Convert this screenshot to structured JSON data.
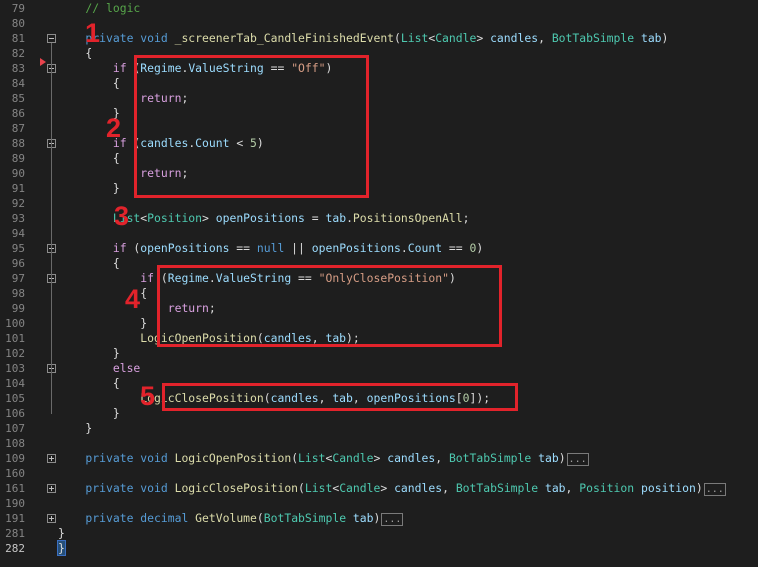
{
  "editor": {
    "lines": [
      {
        "num": "79",
        "segs": [
          [
            "cm",
            "    // logic"
          ]
        ]
      },
      {
        "num": "80",
        "segs": []
      },
      {
        "num": "81",
        "segs": [
          [
            "kw",
            "    private"
          ],
          [
            "pl",
            " "
          ],
          [
            "kw",
            "void"
          ],
          [
            "pl",
            " "
          ],
          [
            "fn",
            "_screenerTab_CandleFinishedEvent"
          ],
          [
            "pl",
            "("
          ],
          [
            "ty",
            "List"
          ],
          [
            "pl",
            "<"
          ],
          [
            "ty",
            "Candle"
          ],
          [
            "pl",
            "> "
          ],
          [
            "id",
            "candles"
          ],
          [
            "pl",
            ", "
          ],
          [
            "ty",
            "BotTabSimple"
          ],
          [
            "pl",
            " "
          ],
          [
            "id",
            "tab"
          ],
          [
            "pl",
            ")"
          ]
        ]
      },
      {
        "num": "82",
        "segs": [
          [
            "pl",
            "    {"
          ]
        ]
      },
      {
        "num": "83",
        "segs": [
          [
            "ctl",
            "        if"
          ],
          [
            "pl",
            " ("
          ],
          [
            "id",
            "Regime"
          ],
          [
            "pl",
            "."
          ],
          [
            "id",
            "ValueString"
          ],
          [
            "pl",
            " == "
          ],
          [
            "st",
            "\"Off\""
          ],
          [
            "pl",
            ")"
          ]
        ]
      },
      {
        "num": "84",
        "segs": [
          [
            "pl",
            "        {"
          ]
        ]
      },
      {
        "num": "85",
        "segs": [
          [
            "ctl",
            "            return"
          ],
          [
            "pl",
            ";"
          ]
        ]
      },
      {
        "num": "86",
        "segs": [
          [
            "pl",
            "        }"
          ]
        ]
      },
      {
        "num": "87",
        "segs": []
      },
      {
        "num": "88",
        "segs": [
          [
            "ctl",
            "        if"
          ],
          [
            "pl",
            " ("
          ],
          [
            "id",
            "candles"
          ],
          [
            "pl",
            "."
          ],
          [
            "id",
            "Count"
          ],
          [
            "pl",
            " < "
          ],
          [
            "nu",
            "5"
          ],
          [
            "pl",
            ")"
          ]
        ]
      },
      {
        "num": "89",
        "segs": [
          [
            "pl",
            "        {"
          ]
        ]
      },
      {
        "num": "90",
        "segs": [
          [
            "ctl",
            "            return"
          ],
          [
            "pl",
            ";"
          ]
        ]
      },
      {
        "num": "91",
        "segs": [
          [
            "pl",
            "        }"
          ]
        ]
      },
      {
        "num": "92",
        "segs": []
      },
      {
        "num": "93",
        "segs": [
          [
            "ty",
            "        List"
          ],
          [
            "pl",
            "<"
          ],
          [
            "ty",
            "Position"
          ],
          [
            "pl",
            "> "
          ],
          [
            "id",
            "openPositions"
          ],
          [
            "pl",
            " = "
          ],
          [
            "id",
            "tab"
          ],
          [
            "pl",
            "."
          ],
          [
            "fn",
            "PositionsOpenAll"
          ],
          [
            "pl",
            ";"
          ]
        ]
      },
      {
        "num": "94",
        "segs": []
      },
      {
        "num": "95",
        "segs": [
          [
            "ctl",
            "        if"
          ],
          [
            "pl",
            " ("
          ],
          [
            "id",
            "openPositions"
          ],
          [
            "pl",
            " == "
          ],
          [
            "kw",
            "null"
          ],
          [
            "pl",
            " || "
          ],
          [
            "id",
            "openPositions"
          ],
          [
            "pl",
            "."
          ],
          [
            "id",
            "Count"
          ],
          [
            "pl",
            " == "
          ],
          [
            "nu",
            "0"
          ],
          [
            "pl",
            ")"
          ]
        ]
      },
      {
        "num": "96",
        "segs": [
          [
            "pl",
            "        {"
          ]
        ]
      },
      {
        "num": "97",
        "segs": [
          [
            "ctl",
            "            if"
          ],
          [
            "pl",
            " ("
          ],
          [
            "id",
            "Regime"
          ],
          [
            "pl",
            "."
          ],
          [
            "id",
            "ValueString"
          ],
          [
            "pl",
            " == "
          ],
          [
            "st",
            "\"OnlyClosePosition\""
          ],
          [
            "pl",
            ")"
          ]
        ]
      },
      {
        "num": "98",
        "segs": [
          [
            "pl",
            "            {"
          ]
        ]
      },
      {
        "num": "99",
        "segs": [
          [
            "ctl",
            "                return"
          ],
          [
            "pl",
            ";"
          ]
        ]
      },
      {
        "num": "100",
        "segs": [
          [
            "pl",
            "            }"
          ]
        ]
      },
      {
        "num": "101",
        "segs": [
          [
            "fn",
            "            LogicOpenPosition"
          ],
          [
            "pl",
            "("
          ],
          [
            "id",
            "candles"
          ],
          [
            "pl",
            ", "
          ],
          [
            "id",
            "tab"
          ],
          [
            "pl",
            ");"
          ]
        ]
      },
      {
        "num": "102",
        "segs": [
          [
            "pl",
            "        }"
          ]
        ]
      },
      {
        "num": "103",
        "segs": [
          [
            "ctl",
            "        else"
          ]
        ]
      },
      {
        "num": "104",
        "segs": [
          [
            "pl",
            "        {"
          ]
        ]
      },
      {
        "num": "105",
        "segs": [
          [
            "fn",
            "            LogicClosePosition"
          ],
          [
            "pl",
            "("
          ],
          [
            "id",
            "candles"
          ],
          [
            "pl",
            ", "
          ],
          [
            "id",
            "tab"
          ],
          [
            "pl",
            ", "
          ],
          [
            "id",
            "openPositions"
          ],
          [
            "pl",
            "["
          ],
          [
            "nu",
            "0"
          ],
          [
            "pl",
            "]);"
          ]
        ]
      },
      {
        "num": "106",
        "segs": [
          [
            "pl",
            "        }"
          ]
        ]
      },
      {
        "num": "107",
        "segs": [
          [
            "pl",
            "    }"
          ]
        ]
      },
      {
        "num": "108",
        "segs": []
      },
      {
        "num": "109",
        "segs": [
          [
            "kw",
            "    private"
          ],
          [
            "pl",
            " "
          ],
          [
            "kw",
            "void"
          ],
          [
            "pl",
            " "
          ],
          [
            "fn",
            "LogicOpenPosition"
          ],
          [
            "pl",
            "("
          ],
          [
            "ty",
            "List"
          ],
          [
            "pl",
            "<"
          ],
          [
            "ty",
            "Candle"
          ],
          [
            "pl",
            "> "
          ],
          [
            "id",
            "candles"
          ],
          [
            "pl",
            ", "
          ],
          [
            "ty",
            "BotTabSimple"
          ],
          [
            "pl",
            " "
          ],
          [
            "id",
            "tab"
          ],
          [
            "pl",
            ")"
          ],
          [
            "collapsed",
            "..."
          ]
        ]
      },
      {
        "num": "160",
        "segs": []
      },
      {
        "num": "161",
        "segs": [
          [
            "kw",
            "    private"
          ],
          [
            "pl",
            " "
          ],
          [
            "kw",
            "void"
          ],
          [
            "pl",
            " "
          ],
          [
            "fn",
            "LogicClosePosition"
          ],
          [
            "pl",
            "("
          ],
          [
            "ty",
            "List"
          ],
          [
            "pl",
            "<"
          ],
          [
            "ty",
            "Candle"
          ],
          [
            "pl",
            "> "
          ],
          [
            "id",
            "candles"
          ],
          [
            "pl",
            ", "
          ],
          [
            "ty",
            "BotTabSimple"
          ],
          [
            "pl",
            " "
          ],
          [
            "id",
            "tab"
          ],
          [
            "pl",
            ", "
          ],
          [
            "ty",
            "Position"
          ],
          [
            "pl",
            " "
          ],
          [
            "id",
            "position"
          ],
          [
            "pl",
            ")"
          ],
          [
            "collapsed",
            "..."
          ]
        ]
      },
      {
        "num": "190",
        "segs": []
      },
      {
        "num": "191",
        "segs": [
          [
            "kw",
            "    private"
          ],
          [
            "pl",
            " "
          ],
          [
            "kw",
            "decimal"
          ],
          [
            "pl",
            " "
          ],
          [
            "fn",
            "GetVolume"
          ],
          [
            "pl",
            "("
          ],
          [
            "ty",
            "BotTabSimple"
          ],
          [
            "pl",
            " "
          ],
          [
            "id",
            "tab"
          ],
          [
            "pl",
            ")"
          ],
          [
            "collapsed",
            "..."
          ]
        ]
      },
      {
        "num": "281",
        "segs": [
          [
            "pl",
            "}"
          ]
        ]
      },
      {
        "num": "282",
        "segs": [
          [
            "cursor",
            "}"
          ]
        ],
        "active": true
      }
    ],
    "folds": [
      {
        "line": 2,
        "type": "minus"
      },
      {
        "line": 4,
        "type": "minus"
      },
      {
        "line": 9,
        "type": "minus"
      },
      {
        "line": 16,
        "type": "minus"
      },
      {
        "line": 18,
        "type": "minus"
      },
      {
        "line": 24,
        "type": "minus"
      },
      {
        "line": 30,
        "type": "plus"
      },
      {
        "line": 32,
        "type": "plus"
      },
      {
        "line": 34,
        "type": "plus"
      }
    ]
  },
  "annotations": [
    {
      "label": "1"
    },
    {
      "label": "2"
    },
    {
      "label": "3"
    },
    {
      "label": "4"
    },
    {
      "label": "5"
    }
  ],
  "colors": {
    "background": "#1e1e1e",
    "annotation": "#e2232b",
    "keyword": "#569cd6",
    "type": "#4ec9b0",
    "method": "#dcdcaa",
    "identifier": "#9cdcfe",
    "string": "#d69d85",
    "number": "#b5cea8",
    "comment": "#57a64a",
    "control": "#d8a0df"
  }
}
